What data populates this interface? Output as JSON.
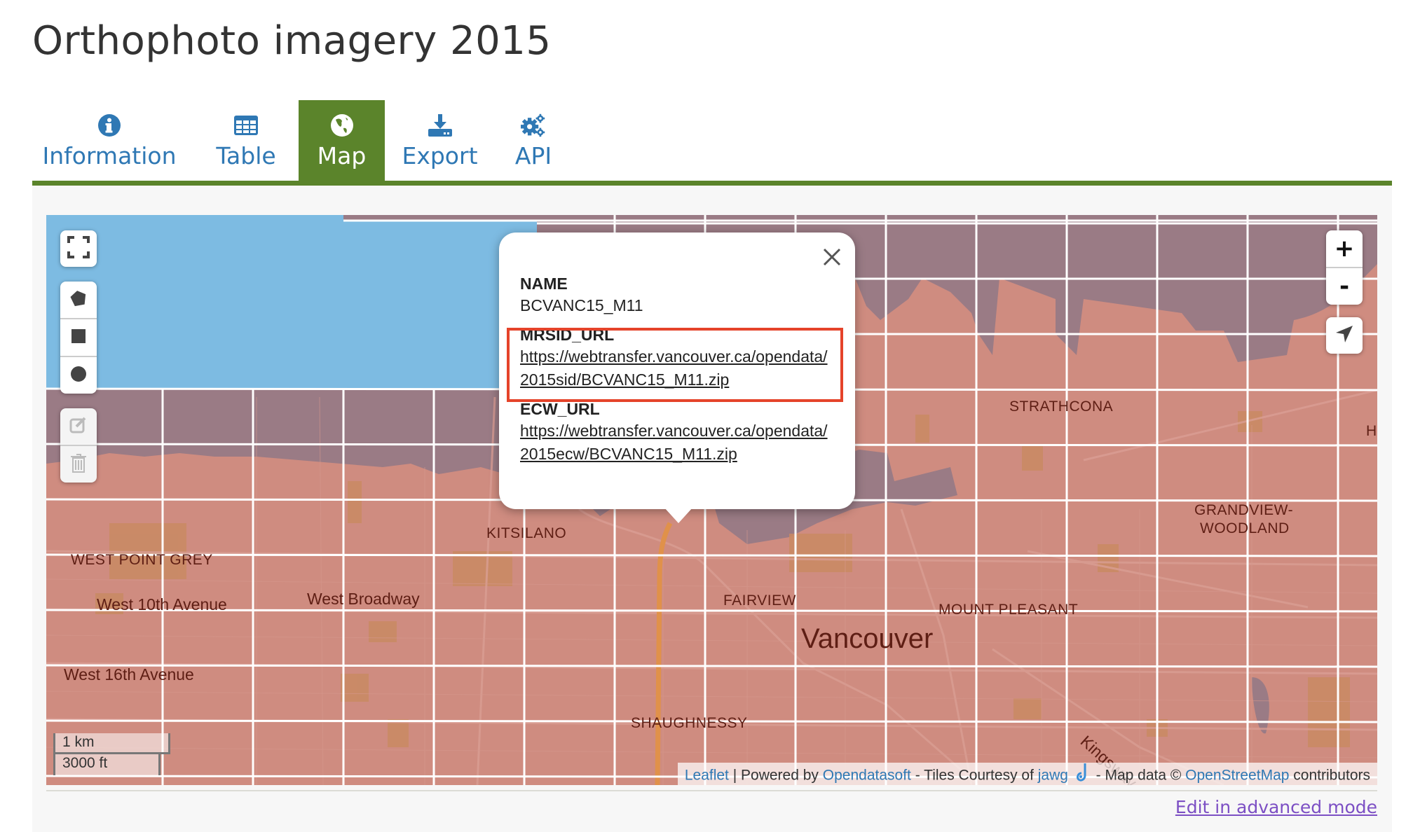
{
  "page": {
    "title": "Orthophoto imagery 2015"
  },
  "tabs": [
    {
      "label": "Information",
      "icon": "info-circle-icon",
      "active": false
    },
    {
      "label": "Table",
      "icon": "table-grid-icon",
      "active": false
    },
    {
      "label": "Map",
      "icon": "globe-icon",
      "active": true
    },
    {
      "label": "Export",
      "icon": "download-icon",
      "active": false
    },
    {
      "label": "API",
      "icon": "gears-icon",
      "active": false
    }
  ],
  "colors": {
    "accent_green": "#5b842b",
    "tab_blue": "#2f78b4",
    "water_blue": "#7dbbe2",
    "water_overlay": "#9a7b85",
    "land": "#cf8c80",
    "highlight_red": "#e5432a",
    "advanced_link": "#7c4fc4"
  },
  "map": {
    "controls": {
      "fullscreen": "fullscreen-icon",
      "draw": [
        "draw-polygon-icon",
        "draw-rectangle-icon",
        "draw-circle-icon"
      ],
      "edit": [
        "edit-icon",
        "delete-icon"
      ],
      "zoom_in": "+",
      "zoom_out": "-",
      "locate": "locate-arrow-icon"
    },
    "labels": {
      "strathcona": "STRATHCONA",
      "kitsilano": "KITSILANO",
      "west_point_grey": "WEST POINT GREY",
      "west_10th": "West 10th Avenue",
      "west_broadway": "West Broadway",
      "fairview": "FAIRVIEW",
      "mount_pleasant": "MOUNT PLEASANT",
      "vancouver": "Vancouver",
      "west_16th": "West 16th Avenue",
      "shaughnessy": "SHAUGHNESSY",
      "kingsway": "Kingsway",
      "grandview_1": "GRANDVIEW-",
      "grandview_2": "WOODLAND",
      "edge_h": "H"
    },
    "scale": {
      "metric": "1 km",
      "imperial": "3000 ft"
    },
    "attribution": {
      "leaflet": "Leaflet",
      "sep1": " | Powered by ",
      "opendatasoft": "Opendatasoft",
      "sep2": " - Tiles Courtesy of ",
      "jawg": "jawg",
      "sep3": " - Map data © ",
      "osm": "OpenStreetMap",
      "sep4": " contributors"
    }
  },
  "popup": {
    "fields": [
      {
        "name": "NAME",
        "value": "BCVANC15_M11",
        "is_link": false
      },
      {
        "name": "MRSID_URL",
        "value": "https://webtransfer.vancouver.ca/opendata/2015sid/BCVANC15_M11.zip",
        "is_link": true,
        "highlighted": true
      },
      {
        "name": "ECW_URL",
        "value": "https://webtransfer.vancouver.ca/opendata/2015ecw/BCVANC15_M11.zip",
        "is_link": true
      }
    ]
  },
  "footer": {
    "advanced_mode_link": "Edit in advanced mode"
  }
}
